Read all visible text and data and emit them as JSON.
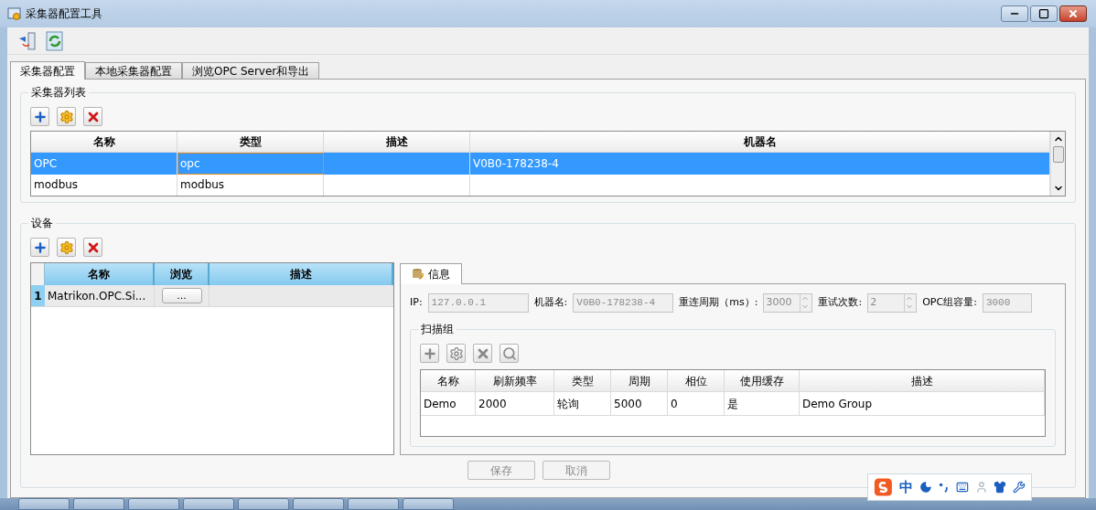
{
  "window": {
    "title": "采集器配置工具"
  },
  "tabs": [
    {
      "label": "采集器配置",
      "selected": true
    },
    {
      "label": "本地采集器配置",
      "selected": false
    },
    {
      "label": "浏览OPC Server和导出",
      "selected": false
    }
  ],
  "collector_list": {
    "title": "采集器列表",
    "columns": [
      "名称",
      "类型",
      "描述",
      "机器名"
    ],
    "rows": [
      {
        "cells": [
          "OPC",
          "opc",
          null,
          "V0B0-178238-4"
        ],
        "selected": true
      },
      {
        "cells": [
          "modbus",
          "modbus",
          null,
          null
        ],
        "selected": false
      }
    ]
  },
  "devices": {
    "title": "设备",
    "columns": [
      "名称",
      "浏览",
      "描述"
    ],
    "rows": [
      {
        "index": "1",
        "name": "Matrikon.OPC.Si...",
        "browse": "...",
        "selected": true
      }
    ]
  },
  "info_tab": {
    "label": "信息"
  },
  "fields": [
    {
      "label": "IP:",
      "value": "127.0.0.1",
      "kind": "text"
    },
    {
      "label": "机器名:",
      "value": "V0B0-178238-4",
      "kind": "text"
    },
    {
      "label": "重连周期（ms）:",
      "value": "3000",
      "kind": "spin"
    },
    {
      "label": "重试次数:",
      "value": "2",
      "kind": "spin"
    },
    {
      "label": "OPC组容量:",
      "value": "3000",
      "kind": "text"
    }
  ],
  "scan_group": {
    "title": "扫描组",
    "columns": [
      "名称",
      "刷新频率",
      "类型",
      "周期",
      "相位",
      "使用缓存",
      "描述"
    ],
    "rows": [
      {
        "cells": [
          "Demo",
          "2000",
          "轮询",
          "5000",
          "0",
          "是",
          "Demo Group"
        ]
      }
    ]
  },
  "buttons": [
    {
      "label": "保存",
      "disabled": true
    },
    {
      "label": "取消",
      "disabled": true
    }
  ],
  "ime": {
    "mode": "中"
  }
}
